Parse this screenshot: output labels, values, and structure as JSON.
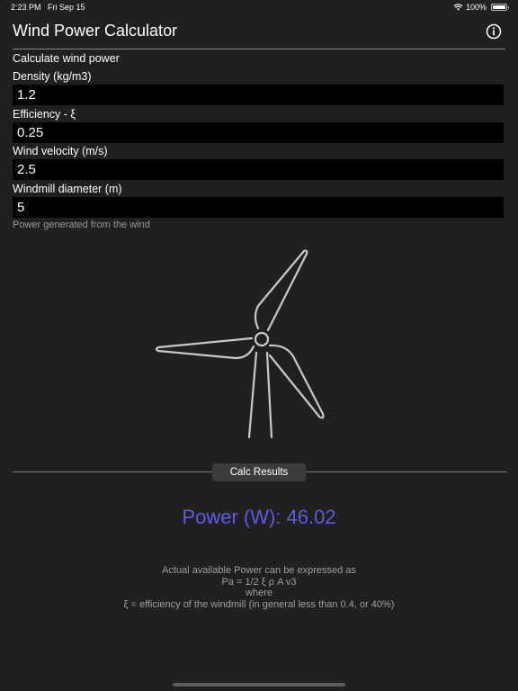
{
  "status_bar": {
    "time": "2:23 PM",
    "date": "Fri Sep 15",
    "battery": "100%"
  },
  "header": {
    "title": "Wind Power Calculator"
  },
  "form": {
    "heading": "Calculate wind power",
    "density": {
      "label": "Density (kg/m3)",
      "value": "1.2"
    },
    "efficiency": {
      "label": "Efficiency - ξ",
      "value": "0.25"
    },
    "velocity": {
      "label": "Wind velocity (m/s)",
      "value": "2.5"
    },
    "diameter": {
      "label": "Windmill diameter (m)",
      "value": "5"
    },
    "subtitle": "Power generated from the wind"
  },
  "calc": {
    "button_label": "Calc Results"
  },
  "result": {
    "text": "Power (W): 46.02"
  },
  "explanation": {
    "lines": [
      "Actual available Power can be expressed as",
      "Pa = 1/2 ξ ρ A v3",
      "where",
      "ξ = efficiency of the windmill (in general less than 0.4, or 40%)"
    ]
  },
  "colors": {
    "background": "#202020",
    "result_accent": "#5f5ce2",
    "field_background": "#000000"
  },
  "icons": {
    "info": "info-circle-icon",
    "turbine": "wind-turbine-icon",
    "wifi": "wifi-icon",
    "battery": "battery-icon"
  }
}
